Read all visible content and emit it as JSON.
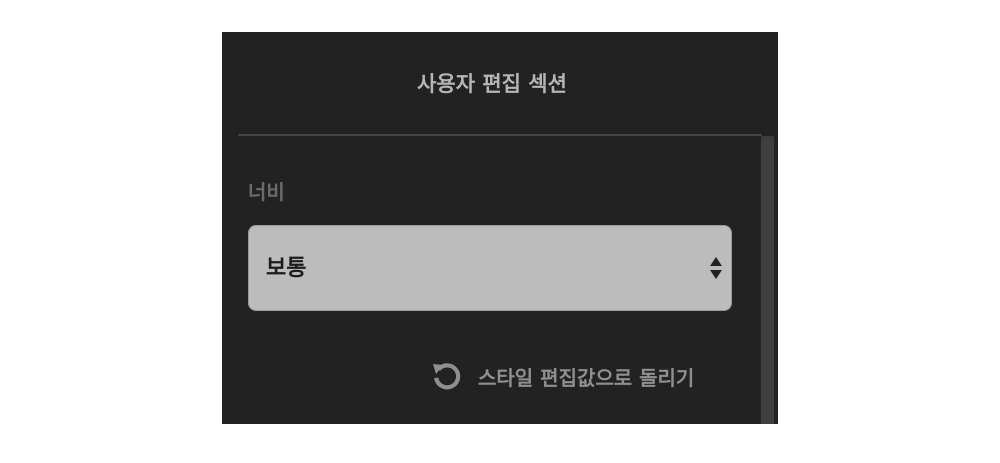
{
  "panel": {
    "title": "사용자 편집 섹션"
  },
  "width_field": {
    "label": "너비",
    "selected_value": "보통"
  },
  "reset": {
    "label": "스타일 편집값으로 돌리기",
    "icon": "reset-icon"
  },
  "colors": {
    "panel_background": "#222222",
    "select_background": "#bcbcbc"
  }
}
